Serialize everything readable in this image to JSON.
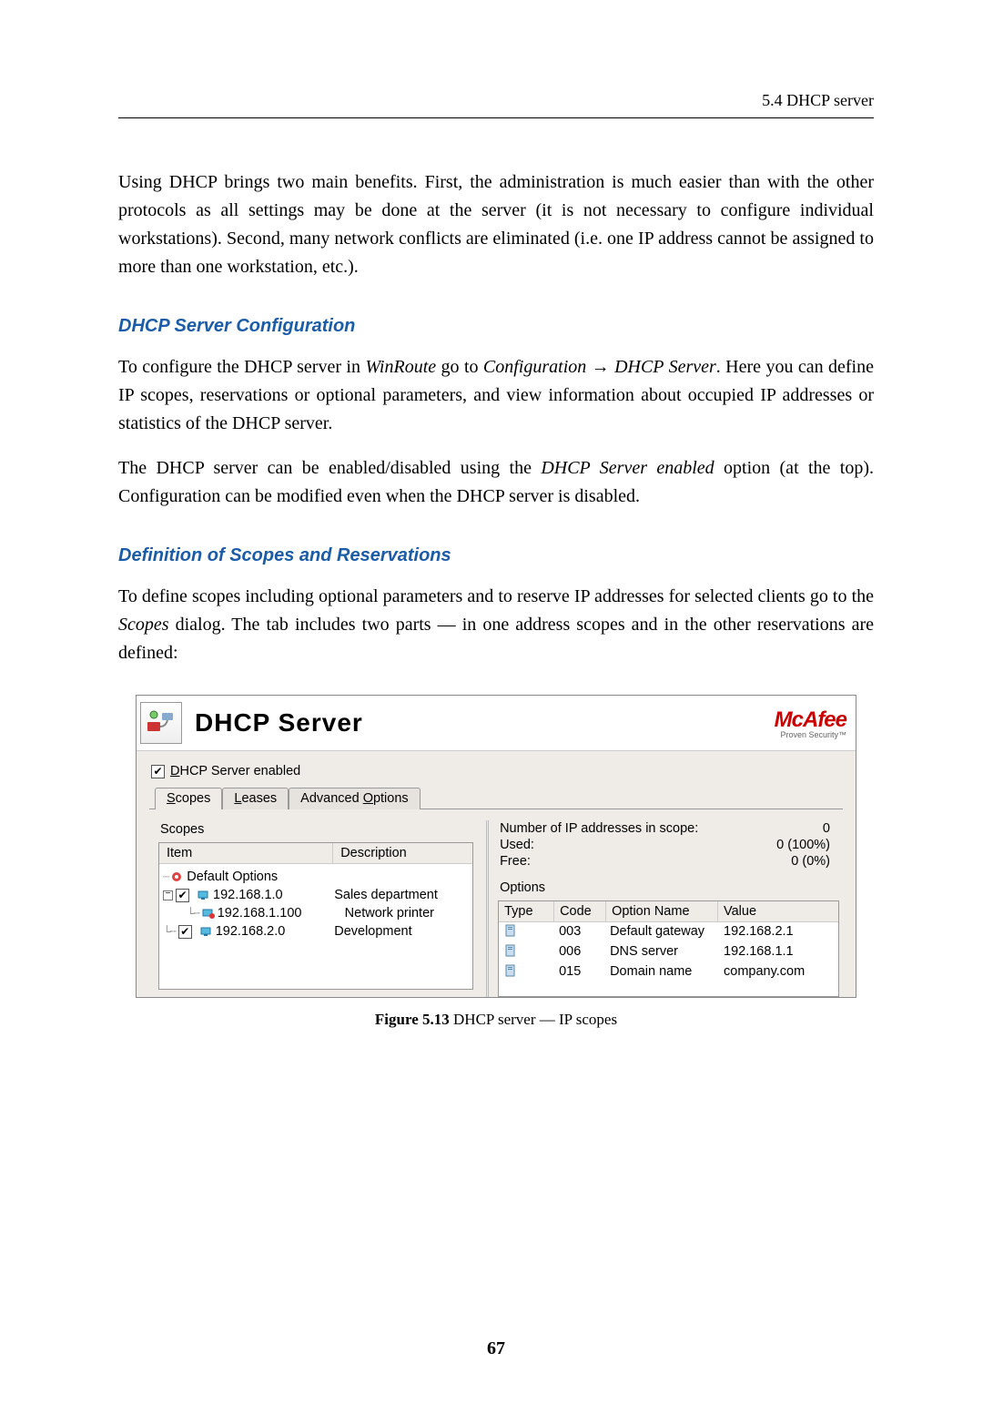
{
  "header": {
    "running": "5.4  DHCP server"
  },
  "para1": "Using DHCP brings two main benefits. First, the administration is much easier than with the other protocols as all settings may be done at the server (it is not necessary to configure individual workstations). Second, many network conflicts are eliminated (i.e. one IP address cannot be assigned to more than one workstation, etc.).",
  "sec1": "DHCP Server Configuration",
  "para2a": "To configure the DHCP server in ",
  "para2b": "WinRoute",
  "para2c": " go to ",
  "para2d": "Configuration → DHCP Server",
  "para2e": ". Here you can define IP scopes, reservations or optional parameters, and view information about occupied IP addresses or statistics of the DHCP server.",
  "para3a": "The DHCP server can be enabled/disabled using the ",
  "para3b": "DHCP Server enabled",
  "para3c": " option (at the top). Configuration can be modified even when the DHCP server is disabled.",
  "sec2": "Definition of Scopes and Reservations",
  "para4a": "To define scopes including optional parameters and to reserve IP addresses for selected clients go to the ",
  "para4b": "Scopes",
  "para4c": " dialog. The tab includes two parts — in one address scopes and in the other reservations are defined:",
  "shot": {
    "title": "DHCP Server",
    "brand": "McAfee",
    "brand_sub": "Proven Security™",
    "enable_label_pre": "D",
    "enable_label_rest": "HCP Server enabled",
    "tabs": {
      "scopes_pre": "S",
      "scopes_rest": "copes",
      "leases_pre": "L",
      "leases_rest": "eases",
      "adv_pre": "Advanced ",
      "adv_u": "O",
      "adv_rest": "ptions"
    },
    "scopes_label": "Scopes",
    "tree_head_item": "Item",
    "tree_head_desc": "Description",
    "tree": {
      "default": "Default Options",
      "r1_ip": "192.168.1.0",
      "r1_desc": "Sales department",
      "r2_ip": "192.168.1.100",
      "r2_desc": "Network printer",
      "r3_ip": "192.168.2.0",
      "r3_desc": "Development"
    },
    "stats": {
      "count_label": "Number of IP addresses in scope:",
      "count_val": "0",
      "used_label": "Used:",
      "used_val": "0 (100%)",
      "free_label": "Free:",
      "free_val": "0 (0%)"
    },
    "options_label": "Options",
    "opt_head": {
      "type": "Type",
      "code": "Code",
      "name": "Option Name",
      "value": "Value"
    },
    "opts": [
      {
        "code": "003",
        "name": "Default gateway",
        "value": "192.168.2.1"
      },
      {
        "code": "006",
        "name": "DNS server",
        "value": "192.168.1.1"
      },
      {
        "code": "015",
        "name": "Domain name",
        "value": "company.com"
      }
    ]
  },
  "caption_bold": "Figure 5.13",
  "caption_rest": "   DHCP server — IP scopes",
  "page_number": "67"
}
